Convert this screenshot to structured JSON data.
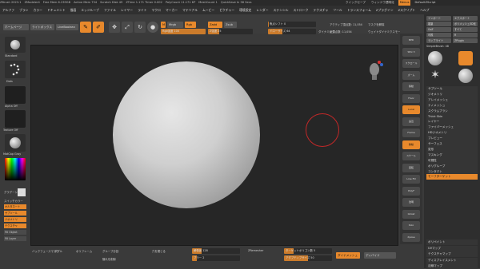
{
  "titlebar": [
    "ZBrush 2023.1",
    "ZModeler4",
    "Free Mem 6.239GB",
    "Active Mem 734",
    "Scratch Disk 49",
    "ZTime 1.171 Timer 0.002",
    "PolyCount 11.171 KP",
    "MeshCount 1",
    "QuickSave In 58 Secs"
  ],
  "titlebar_right": [
    "クイックセーブ",
    "ウィンドウ透明化",
    "Menus",
    "DefaultZScript"
  ],
  "menus": [
    "アルファ",
    "ブラシ",
    "カラー",
    "ドキュメント",
    "描画",
    "エッジループ",
    "ファイル",
    "レイヤー",
    "ライト",
    "マクロ",
    "マーカー",
    "マテリアル",
    "ムービー",
    "ピクチャー",
    "環境設定",
    "レンダー",
    "ステンシル",
    "ストローク",
    "テクスチャ",
    "ツール",
    "トランスフォーム",
    "Zプラグイン",
    "Zスクリプト",
    "ヘルプ"
  ],
  "toolbar": {
    "home": "ホームページ",
    "lightbox": "ライトボックス",
    "liveboolean": "LiveBoolean",
    "edit": "編集",
    "draw": "ドロー",
    "move": "移動",
    "scale": "スケール",
    "rotate": "回転",
    "mrgb": "Mrgb",
    "rgb": "Rgb",
    "m": "M",
    "zadd": "Zadd",
    "zsub": "Zsub",
    "zcut": "Zcut",
    "rgb_intensity": "Rgb強度 100",
    "z_intensity": "Z強度 25",
    "focal_shift": "焦点シフト 0",
    "draw_size": "ドローサイズ 64",
    "dynamic": "ダイナミック",
    "active_points": "アクティブ頂点数: 11,054",
    "total_points": "総頂点数: 11,054",
    "cancel_mask": "マスクを解除",
    "sharpen": "ウェイトダイナミクスモード"
  },
  "right_toolbar": [
    "BPR",
    "SPix 3",
    "スクロール",
    "ズーム",
    "移動",
    "Floor",
    "Local",
    "遠近",
    "Frame",
    "移動",
    "スケール",
    "回転",
    "Line Fill",
    "PolyF",
    "透明",
    "Ghost",
    "Solo",
    "Xpose"
  ],
  "right_panel": {
    "top_buttons": [
      "インポート",
      "エクスポート",
      "複製",
      "ポリメッシュ3D化",
      "GoZ",
      "すべて",
      "可視",
      "R",
      "ランプライト",
      "ZPlugin"
    ],
    "tool_label": "SimpleBrush: 48",
    "thumbs": [
      "Sphere3D",
      "PolyMesh3D",
      "SimpleBrush",
      "Sphere3D_1",
      "PolySphere"
    ],
    "items": [
      "サブツール",
      "ジオメトリ",
      "アレイメッシュ",
      "ナノメッシュ",
      "スクラムブラシ",
      "Thick Skin",
      "レイヤー",
      "ファイバーメッシュ",
      "HDジオメトリ",
      "プレビュー",
      "サーフェス",
      "変形",
      "マスキング",
      "可視性",
      "ポリグループ",
      "コンタクト",
      "モーフターゲット",
      "ポリペイント",
      "UVマップ",
      "テクスチャマップ",
      "ディスプレイスメント",
      "法線マップ"
    ],
    "morph": "モーフターゲット"
  },
  "left_panel": {
    "brush": "Standard",
    "stroke": "Dots",
    "alpha": "Alpha Off",
    "texture": "Texture Off",
    "material": "MatCap Gray",
    "gradient": "グラデーション",
    "switch_color": "スイッチカラー",
    "alternate": "オルタネート",
    "items": [
      "サブツール",
      "ジオメトリ",
      "テクスチャ",
      "Fill Object",
      "Fill Layer"
    ]
  },
  "bottom": {
    "backface": "バックフェースマスク",
    "double": "ダブル",
    "polyframe": "ポリフレーム",
    "group_frame": "グループ分割",
    "delete_hidden": "隠れを削除",
    "close_holes": "穴を閉じる",
    "dynamesh": "ダイナメッシュ",
    "resolution": "解像度 128",
    "blur": "ブラー 2",
    "project": "プロジェクト",
    "polish": "ポリッシュ",
    "groups": "グループ",
    "zremesher": "ZRemesher",
    "target": "ターゲットポリゴン数 5",
    "adapt": "アダプティブサイズ 50",
    "smooth": "スムーズ 0",
    "subdiv": "SDiv 2",
    "divide": "ディバイド",
    "lower": "下位レベル",
    "higher": "上位レベル",
    "del_lower": "下位を削除",
    "del_higher": "上位を削除"
  },
  "colors": {
    "accent": "#e8892c",
    "canvas": "#262626",
    "panel": "#3a3a3a",
    "brush_ring": "#c22828"
  }
}
